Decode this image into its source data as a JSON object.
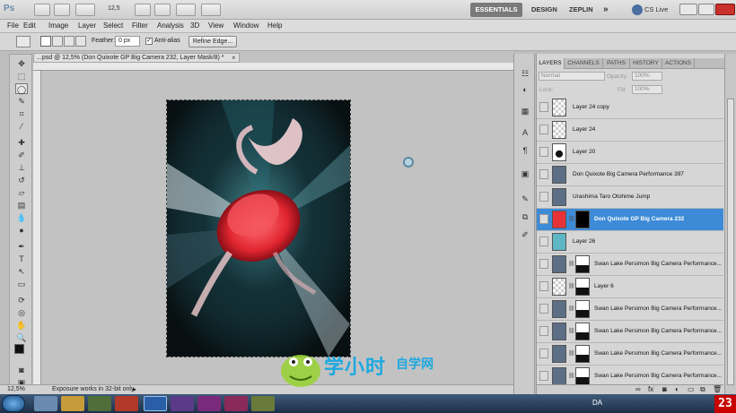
{
  "appbar": {
    "logo": "Ps",
    "zoom_value": "12,5",
    "workspaces": [
      "ESSENTIALS",
      "DESIGN",
      "ZEPLIN"
    ],
    "more": "»",
    "cslive": "CS Live"
  },
  "menu": [
    "File",
    "Edit",
    "Image",
    "Layer",
    "Select",
    "Filter",
    "Analysis",
    "3D",
    "View",
    "Window",
    "Help"
  ],
  "options": {
    "feather_label": "Feather:",
    "feather_value": "0 px",
    "antialias_label": "Anti-alias",
    "refine_edge": "Refine Edge..."
  },
  "document": {
    "tab_title": "...psd @ 12,5% (Don Quixote GP Big Camera 232, Layer Mask/8) *",
    "zoom": "12,5%",
    "status": "Exposure works in 32-bit only"
  },
  "panel": {
    "tabs": [
      "LAYERS",
      "CHANNELS",
      "PATHS",
      "HISTORY",
      "ACTIONS"
    ],
    "blend_mode": "Normal",
    "opacity_label": "Opacity:",
    "opacity_value": "100%",
    "lock_label": "Lock:",
    "fill_label": "Fill:",
    "fill_value": "100%"
  },
  "layers": [
    {
      "name": "Layer 24 copy",
      "thumb": "checker",
      "mask": false,
      "selected": false
    },
    {
      "name": "Layer 24",
      "thumb": "checker",
      "mask": false,
      "selected": false
    },
    {
      "name": "Layer 20",
      "thumb": "figure",
      "mask": false,
      "selected": false
    },
    {
      "name": "Don Quixote Big Camera Performance 397",
      "thumb": "photo",
      "mask": false,
      "selected": false
    },
    {
      "name": "Urashima Taro Otohime Jump",
      "thumb": "photo",
      "mask": false,
      "selected": false
    },
    {
      "name": "Don Quixote GP Big Camera 232",
      "thumb": "red",
      "mask": true,
      "selected": true
    },
    {
      "name": "Layer 26",
      "thumb": "cyan",
      "mask": false,
      "selected": false
    },
    {
      "name": "Swan Lake Persimon Big Camera Performance...",
      "thumb": "photo",
      "mask": true,
      "selected": false
    },
    {
      "name": "Layer 6",
      "thumb": "checker",
      "mask": true,
      "selected": false
    },
    {
      "name": "Swan Lake Persimon Big Camera Performance...",
      "thumb": "photo",
      "mask": true,
      "selected": false
    },
    {
      "name": "Swan Lake Persimon Big Camera Performance...",
      "thumb": "photo",
      "mask": true,
      "selected": false
    },
    {
      "name": "Swan Lake Persimon Big Camera Performance...",
      "thumb": "photo",
      "mask": true,
      "selected": false
    },
    {
      "name": "Swan Lake Persimon Big Camera Performance...",
      "thumb": "photo",
      "mask": true,
      "selected": false
    }
  ],
  "taskbar": {
    "lang": "DA",
    "clock_badge": "23"
  },
  "watermark": {
    "line1": "学小时",
    "line2": "自学网"
  },
  "colors": {
    "selection": "#3d8bd7",
    "taskbar": "#1d2f47",
    "artwork_red": "#e8323a"
  }
}
